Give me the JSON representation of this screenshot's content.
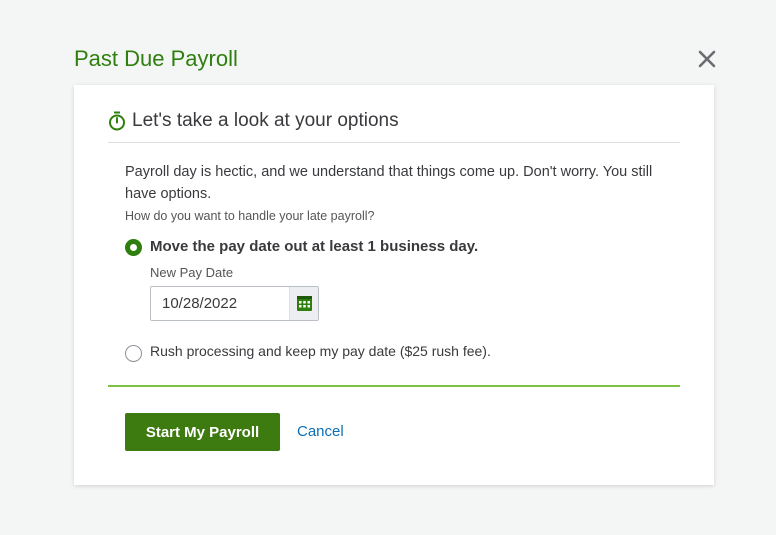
{
  "modal": {
    "title": "Past Due Payroll",
    "close_icon": "close-icon"
  },
  "section": {
    "icon": "stopwatch-icon",
    "title": "Let's take a look at your options"
  },
  "intro": "Payroll day is hectic, and we understand that things come up. Don't worry. You still have options.",
  "question": "How do you want to handle your late payroll?",
  "options": [
    {
      "label": "Move the pay date out at least 1 business day.",
      "selected": true,
      "date_field": {
        "label": "New Pay Date",
        "value": "10/28/2022",
        "icon": "calendar-icon"
      }
    },
    {
      "label": "Rush processing and keep my pay date ($25 rush fee).",
      "selected": false
    }
  ],
  "actions": {
    "primary_label": "Start My Payroll",
    "cancel_label": "Cancel"
  },
  "colors": {
    "title_green": "#2e7f0e",
    "button_green": "#3d7a10",
    "divider_green": "#7fc241",
    "link_blue": "#0d6fb8"
  }
}
